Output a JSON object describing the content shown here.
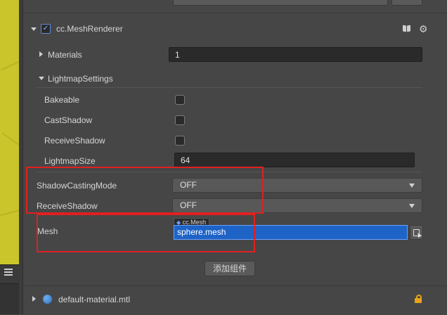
{
  "component": {
    "name": "cc.MeshRenderer",
    "enabled": true
  },
  "properties": {
    "materials": {
      "label": "Materials",
      "value": "1"
    },
    "lightmap_settings": {
      "label": "LightmapSettings",
      "bakeable": {
        "label": "Bakeable",
        "checked": false
      },
      "cast_shadow": {
        "label": "CastShadow",
        "checked": false
      },
      "receive_shadow": {
        "label": "ReceiveShadow",
        "checked": false
      },
      "lightmap_size": {
        "label": "LightmapSize",
        "value": "64"
      }
    },
    "shadow_casting_mode": {
      "label": "ShadowCastingMode",
      "value": "OFF"
    },
    "receive_shadow": {
      "label": "ReceiveShadow",
      "value": "OFF"
    },
    "mesh": {
      "label": "Mesh",
      "type_tag": "cc.Mesh",
      "value": "sphere.mesh"
    }
  },
  "add_component_label": "添加组件",
  "asset": {
    "name": "default-material.mtl"
  },
  "icons": {
    "book": "book-icon",
    "gear": "gear-icon",
    "lock": "lock-icon",
    "globe": "globe-icon",
    "hamburger": "hamburger-icon"
  },
  "colors": {
    "panel_bg": "#464646",
    "scene_bg": "#c9c52a",
    "highlight_border": "#e02020",
    "selected_field": "#1e63c6",
    "lock": "#e8a21a"
  }
}
